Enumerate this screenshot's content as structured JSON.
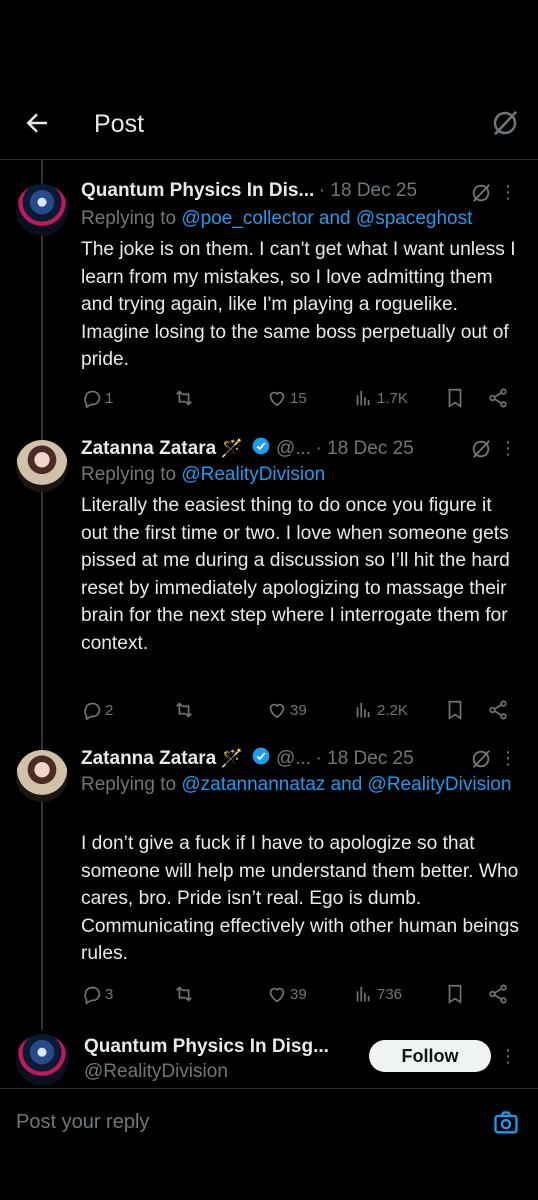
{
  "header": {
    "title": "Post"
  },
  "posts": [
    {
      "name": "Quantum Physics In Dis...",
      "handle": "",
      "date": "18 Dec 25",
      "replying_prefix": "Replying to ",
      "replying_links": "@poe_collector and @spaceghost",
      "body": "The joke is on them. I can't get what I want unless I learn from my mistakes, so I love admitting them and trying again, like I'm playing a roguelike. Imagine losing to the same boss perpetually out of pride.",
      "replies": "1",
      "reposts": "",
      "likes": "15",
      "views": "1.7K"
    },
    {
      "name": "Zatanna Zatara",
      "handle": "@...",
      "date": "18 Dec 25",
      "replying_prefix": "Replying to ",
      "replying_links": "@RealityDivision",
      "body": "Literally the easiest thing to do once you figure it out the first time or two. I love when someone gets pissed at me during a discussion so I’ll hit the hard reset by immediately apologizing to massage their brain for the next step where I interrogate them for context.",
      "replies": "2",
      "reposts": "",
      "likes": "39",
      "views": "2.2K"
    },
    {
      "name": "Zatanna Zatara",
      "handle": "@...",
      "date": "18 Dec 25",
      "replying_prefix": "Replying to ",
      "replying_links": "@zatannannataz and @RealityDivision",
      "body": "I don’t give a fuck if I have to apologize so that someone will help me understand them better. Who cares, bro. Pride isn’t real. Ego is dumb. Communicating effectively with other human beings rules.",
      "replies": "3",
      "reposts": "",
      "likes": "39",
      "views": "736"
    }
  ],
  "author_card": {
    "name": "Quantum Physics In Disg...",
    "handle": "@RealityDivision",
    "follow_label": "Follow"
  },
  "composer": {
    "placeholder": "Post your reply"
  },
  "colors": {
    "accent": "#1d9bf0",
    "muted": "#71767b",
    "text": "#e7e9ea",
    "background": "#000000"
  },
  "icons": [
    "back-arrow-icon",
    "grok-icon",
    "more-icon",
    "reply-icon",
    "repost-icon",
    "like-icon",
    "views-icon",
    "bookmark-icon",
    "share-icon",
    "verified-icon",
    "wand-icon",
    "camera-icon"
  ]
}
